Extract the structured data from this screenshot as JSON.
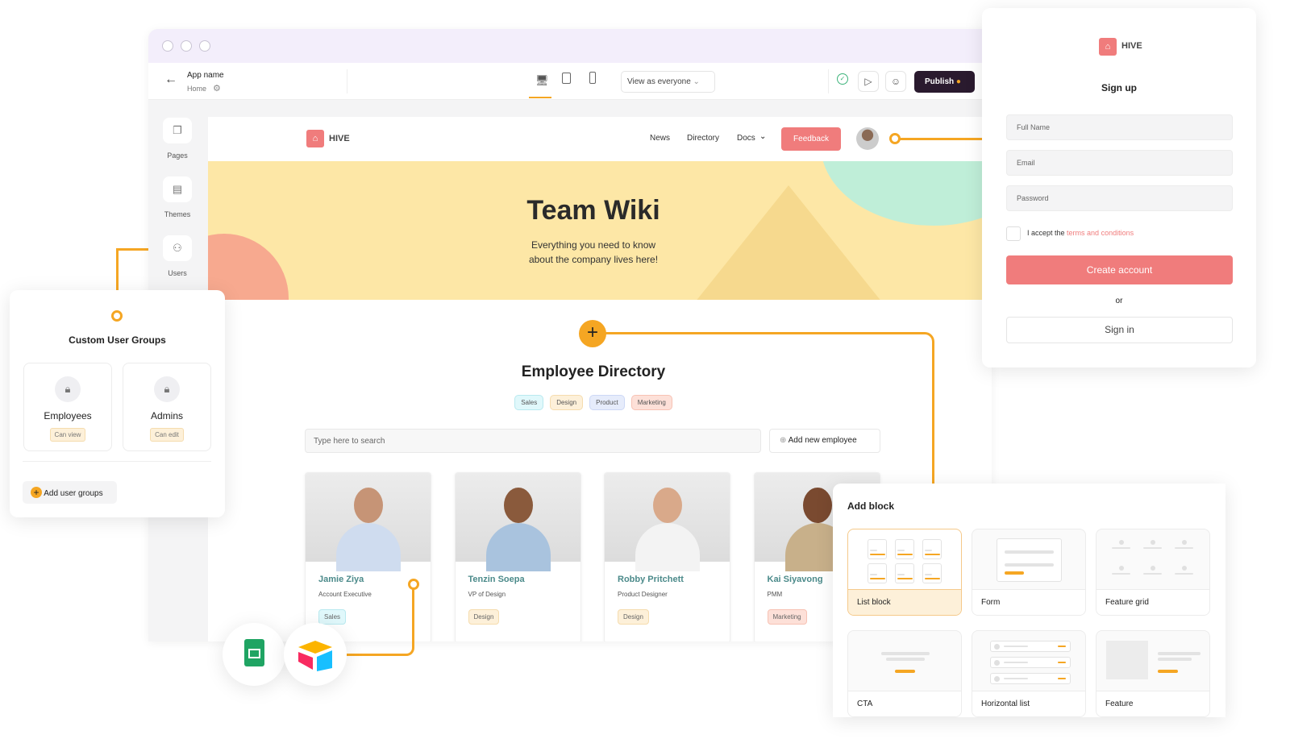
{
  "toolbar": {
    "app_name": "App name",
    "page": "Home",
    "view_as": "View as everyone",
    "publish": "Publish"
  },
  "rail": [
    {
      "label": "Pages",
      "icon": "pages-icon"
    },
    {
      "label": "Themes",
      "icon": "themes-icon"
    },
    {
      "label": "Users",
      "icon": "users-icon"
    }
  ],
  "site": {
    "brand": "HIVE",
    "nav": [
      "News",
      "Directory",
      "Docs"
    ],
    "feedback": "Feedback",
    "hero_title": "Team Wiki",
    "hero_sub1": "Everything you need to know",
    "hero_sub2": "about the company lives here!",
    "dir_title": "Employee Directory",
    "filters": [
      {
        "label": "Sales",
        "bg": "#e0f8fb",
        "bd": "#b9e9ef"
      },
      {
        "label": "Design",
        "bg": "#fdf0d9",
        "bd": "#f5dcae"
      },
      {
        "label": "Product",
        "bg": "#e6ecfb",
        "bd": "#cdd8f5"
      },
      {
        "label": "Marketing",
        "bg": "#fde0d8",
        "bd": "#f7c2b4"
      }
    ],
    "search_placeholder": "Type here to search",
    "add_employee": "Add new employee",
    "employees": [
      {
        "name": "Jamie Ziya",
        "role": "Account Executive",
        "tag": "Sales"
      },
      {
        "name": "Tenzin Soepa",
        "role": "VP of Design",
        "tag": "Design"
      },
      {
        "name": "Robby Pritchett",
        "role": "Product Designer",
        "tag": "Design"
      },
      {
        "name": "Kai Siyavong",
        "role": "PMM",
        "tag": "Marketing"
      }
    ]
  },
  "signup": {
    "brand": "HIVE",
    "title": "Sign up",
    "full_name": "Full Name",
    "email": "Email",
    "password": "Password",
    "accept": "I accept the",
    "terms": "terms and conditions",
    "create": "Create account",
    "or": "or",
    "signin": "Sign in"
  },
  "groups": {
    "title": "Custom User Groups",
    "items": [
      {
        "name": "Employees",
        "perm": "Can view"
      },
      {
        "name": "Admins",
        "perm": "Can edit"
      }
    ],
    "add": "Add user groups"
  },
  "blocks": {
    "title": "Add block",
    "items": [
      "List block",
      "Form",
      "Feature grid",
      "CTA",
      "Horizontal list",
      "Feature"
    ]
  },
  "integrations": [
    "google-sheets-icon",
    "airtable-icon"
  ],
  "colors": {
    "accent": "#f5a623",
    "coral": "#f07c7c",
    "teal": "#4b8a8a",
    "hero": "#fde7a6"
  }
}
